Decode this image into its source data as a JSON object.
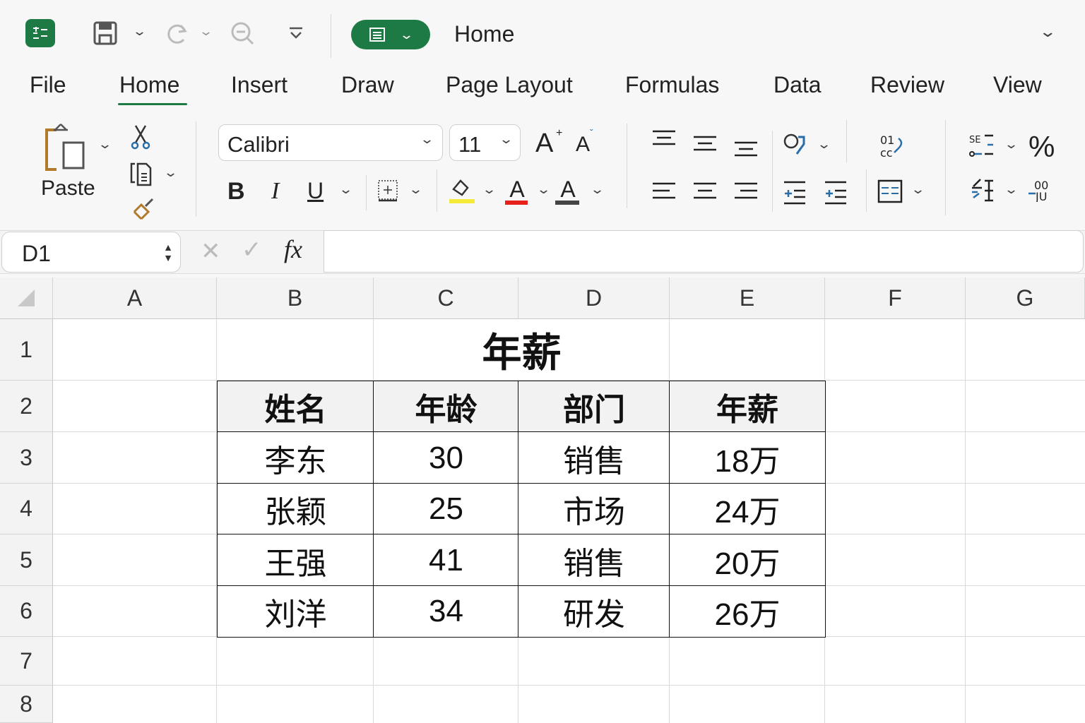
{
  "titlebar": {
    "title": "Home"
  },
  "tabs": [
    {
      "label": "File"
    },
    {
      "label": "Home"
    },
    {
      "label": "Insert"
    },
    {
      "label": "Draw"
    },
    {
      "label": "Page Layout"
    },
    {
      "label": "Formulas"
    },
    {
      "label": "Data"
    },
    {
      "label": "Review"
    },
    {
      "label": "View"
    }
  ],
  "ribbon": {
    "paste_label": "Paste",
    "font_name": "Calibri",
    "font_size": "11",
    "bold": "B",
    "italic": "I",
    "underline": "U",
    "grow": "A",
    "shrink": "A",
    "font_color": "A",
    "percent": "%",
    "colors": {
      "highlight": "#f5e93a",
      "font_color": "#e8201c",
      "accent": "#1e7a44"
    }
  },
  "formula_bar": {
    "name_box": "D1",
    "fx": "fx",
    "value": ""
  },
  "columns": [
    "A",
    "B",
    "C",
    "D",
    "E",
    "F",
    "G"
  ],
  "rows": [
    "1",
    "2",
    "3",
    "4",
    "5",
    "6",
    "7",
    "8"
  ],
  "sheet": {
    "title": "年薪",
    "headers": [
      "姓名",
      "年龄",
      "部门",
      "年薪"
    ],
    "data": [
      [
        "李东",
        "30",
        "销售",
        "18万"
      ],
      [
        "张颖",
        "25",
        "市场",
        "24万"
      ],
      [
        "王强",
        "41",
        "销售",
        "20万"
      ],
      [
        "刘洋",
        "34",
        "研发",
        "26万"
      ]
    ]
  }
}
